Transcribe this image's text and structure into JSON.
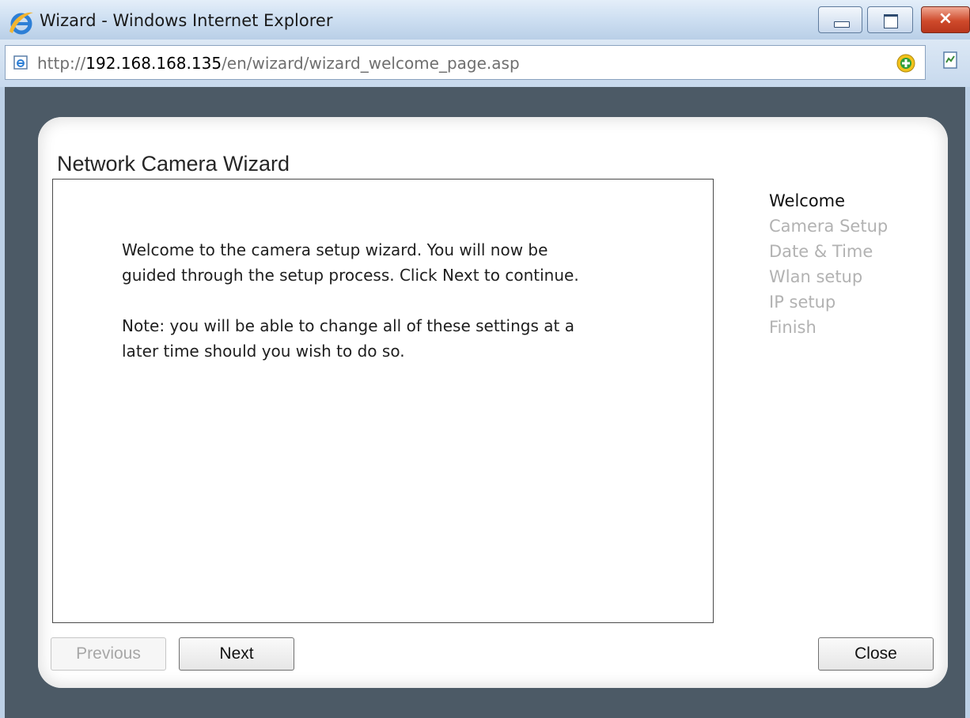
{
  "window": {
    "title": "Wizard - Windows Internet Explorer",
    "close_glyph": "×"
  },
  "address": {
    "url_prefix": "http://",
    "url_host": "192.168.168.135",
    "url_path": "/en/wizard/wizard_welcome_page.asp"
  },
  "wizard": {
    "title": "Network Camera Wizard",
    "paragraphs": [
      "Welcome to the camera setup wizard. You will now be guided through the setup process. Click Next to continue.",
      "Note: you will be able to change all of these settings at a later time should you wish to do so."
    ],
    "steps": [
      "Welcome",
      "Camera Setup",
      "Date & Time",
      "Wlan setup",
      "IP setup",
      "Finish"
    ],
    "active_step": "Welcome",
    "buttons": {
      "previous": "Previous",
      "next": "Next",
      "close": "Close"
    }
  },
  "icons": {
    "browser": "internet-explorer-icon",
    "page": "page-icon",
    "addon": "addon-plus-icon",
    "compat": "compatibility-view-icon"
  },
  "colors": {
    "background": "#4c5a66",
    "step_inactive": "#b2b2b2",
    "step_active": "#101010"
  }
}
